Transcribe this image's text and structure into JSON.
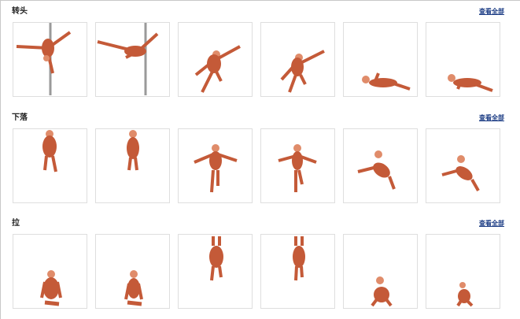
{
  "sections": [
    {
      "title": "转头",
      "view_all": "查看全部",
      "thumbs": [
        "pole-spin-1",
        "pole-spin-2",
        "leap-1",
        "leap-2",
        "lying-1",
        "lying-2"
      ]
    },
    {
      "title": "下落",
      "view_all": "查看全部",
      "thumbs": [
        "fall-back-1",
        "fall-back-2",
        "fall-arms-1",
        "fall-arms-2",
        "tumble-1",
        "tumble-2"
      ]
    },
    {
      "title": "拉",
      "view_all": "查看全部",
      "thumbs": [
        "kneel-1",
        "kneel-2",
        "hang-1",
        "hang-2",
        "crouch-1",
        "crouch-2"
      ]
    }
  ]
}
